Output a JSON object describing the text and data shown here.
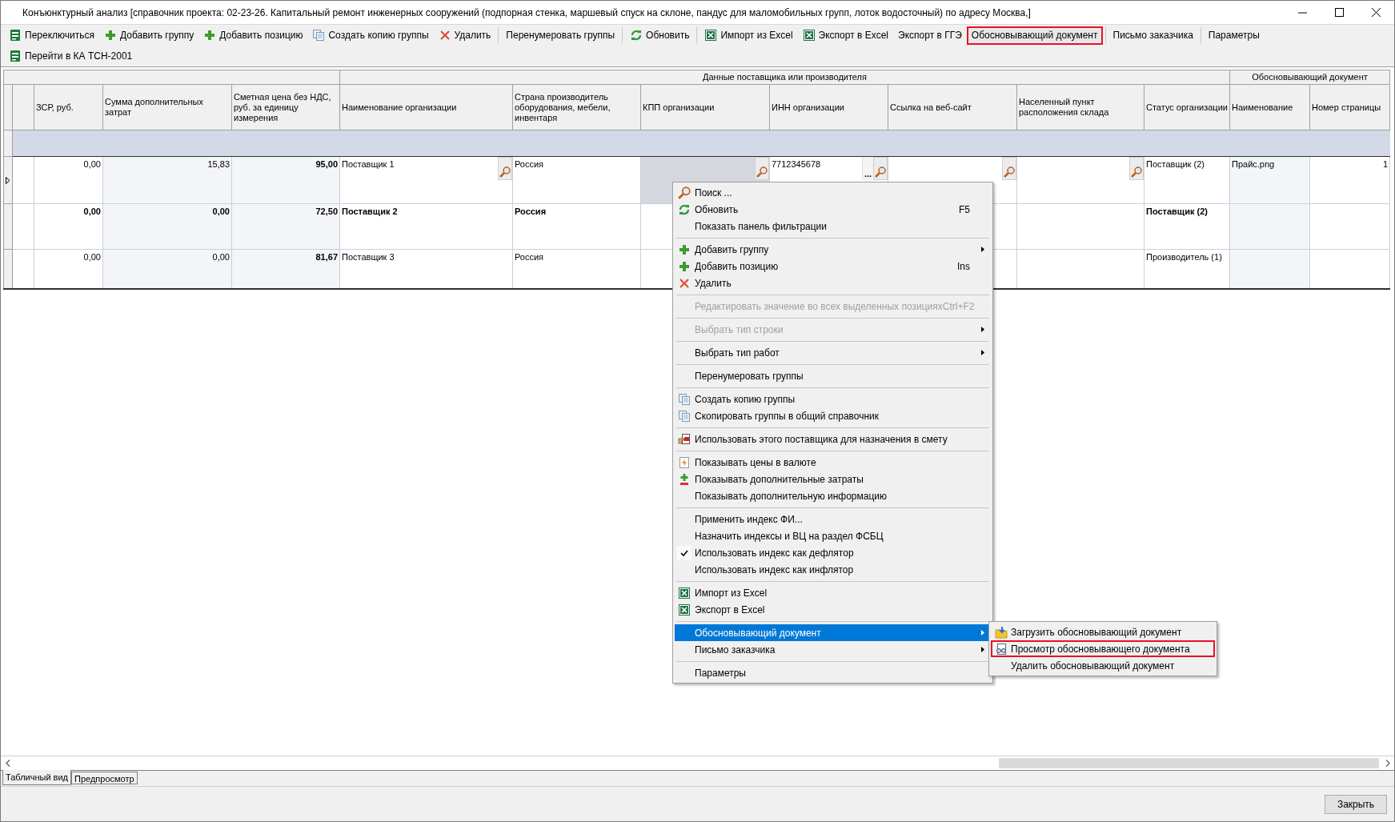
{
  "window": {
    "title": "Конъюнктурный анализ [справочник проекта: 02-23-26. Капитальный ремонт инженерных сооружений (подпорная стенка, маршевый спуск на склоне, пандус для маломобильных групп, лоток водосточный) по адресу Москва,]"
  },
  "toolbar": [
    {
      "label": "Переключиться"
    },
    {
      "label": "Добавить группу"
    },
    {
      "label": "Добавить позицию"
    },
    {
      "label": "Создать копию группы"
    },
    {
      "label": "Удалить"
    },
    {
      "label": "Перенумеровать группы",
      "separator_before": true
    },
    {
      "label": "Обновить",
      "separator_before": true
    },
    {
      "label": "Импорт из Excel",
      "separator_before": true
    },
    {
      "label": "Экспорт в Excel"
    },
    {
      "label": "Экспорт в ГГЭ"
    },
    {
      "label": "Обосновывающий документ",
      "highlighted": true
    },
    {
      "label": "Письмо заказчика",
      "separator_before": true
    },
    {
      "label": "Параметры",
      "separator_before": true
    }
  ],
  "toolbar_2": [
    {
      "label": "Перейти в КА ТСН-2001"
    }
  ],
  "table": {
    "header_groups": [
      {
        "columns": [
          {
            "label": "ЗСР, руб.",
            "kind": "number"
          },
          {
            "label": "Сумма дополнительных затрат",
            "kind": "number",
            "shaded": true
          },
          {
            "label": "Сметная цена без НДС, руб. за единицу измерения",
            "kind": "number",
            "shaded": true,
            "bold": true
          }
        ]
      },
      {
        "label": "Данные поставщика или производителя",
        "columns": [
          {
            "label": "Наименование организации",
            "kind": "text"
          },
          {
            "label": "Страна производитель оборудования, мебели, инвентаря",
            "kind": "text"
          },
          {
            "label": "КПП организации",
            "kind": "text"
          },
          {
            "label": "ИНН организации",
            "kind": "text"
          },
          {
            "label": "Ссылка на веб-сайт",
            "kind": "text"
          },
          {
            "label": "Населенный пункт расположения склада",
            "kind": "text"
          },
          {
            "label": "Статус организации",
            "kind": "text"
          }
        ]
      },
      {
        "label": "Обосновывающий документ",
        "columns": [
          {
            "label": "Наименование",
            "kind": "text",
            "shaded": true
          },
          {
            "label": "Номер страницы",
            "kind": "number"
          }
        ]
      }
    ],
    "rows": [
      {
        "kind": "group"
      },
      {
        "kind": "item",
        "current": true,
        "bold": false,
        "cells": [
          {
            "text": "0,00"
          },
          {
            "text": "15,83"
          },
          {
            "text": "95,00"
          },
          {
            "text": "Поставщик 1",
            "lookup": true
          },
          {
            "text": "Россия"
          },
          {
            "focused": true,
            "lookup": true
          },
          {
            "text": "7712345678",
            "button_text": "...",
            "lookup": true
          },
          {
            "lookup": true
          },
          {
            "lookup": true
          },
          {
            "text": "Поставщик (2)"
          },
          {
            "text": "Прайс.png"
          },
          {
            "text": "1"
          }
        ]
      },
      {
        "kind": "item",
        "current": false,
        "bold": true,
        "cells": [
          {
            "text": "0,00"
          },
          {
            "text": "0,00"
          },
          {
            "text": "72,50"
          },
          {
            "text": "Поставщик 2"
          },
          {
            "text": "Россия"
          },
          {},
          {},
          {},
          {},
          {
            "text": "Поставщик (2)"
          },
          {},
          {}
        ]
      },
      {
        "kind": "item",
        "current": false,
        "bold": false,
        "cells": [
          {
            "text": "0,00"
          },
          {
            "text": "0,00"
          },
          {
            "text": "81,67"
          },
          {
            "text": "Поставщик 3"
          },
          {
            "text": "Россия"
          },
          {},
          {},
          {},
          {},
          {
            "text": "Производитель (1)"
          },
          {},
          {}
        ]
      }
    ]
  },
  "context_menu": [
    {
      "kind": "item",
      "label": "Поиск ..."
    },
    {
      "kind": "item",
      "label": "Обновить",
      "shortcut": "F5"
    },
    {
      "kind": "item",
      "label": "Показать панель фильтрации"
    },
    {
      "kind": "separator"
    },
    {
      "kind": "item",
      "label": "Добавить группу",
      "submenu": true
    },
    {
      "kind": "item",
      "label": "Добавить позицию",
      "shortcut": "Ins"
    },
    {
      "kind": "item",
      "label": "Удалить"
    },
    {
      "kind": "separator"
    },
    {
      "kind": "item",
      "label": "Редактировать значение во всех выделенных позициях",
      "shortcut": "Ctrl+F2",
      "disabled": true
    },
    {
      "kind": "separator"
    },
    {
      "kind": "item",
      "label": "Выбрать тип строки",
      "submenu": true,
      "disabled": true
    },
    {
      "kind": "separator"
    },
    {
      "kind": "item",
      "label": "Выбрать тип работ",
      "submenu": true
    },
    {
      "kind": "separator"
    },
    {
      "kind": "item",
      "label": "Перенумеровать группы"
    },
    {
      "kind": "separator"
    },
    {
      "kind": "item",
      "label": "Создать копию группы"
    },
    {
      "kind": "item",
      "label": "Скопировать группы в общий справочник"
    },
    {
      "kind": "separator"
    },
    {
      "kind": "item",
      "label": "Использовать этого поставщика для назначения в смету"
    },
    {
      "kind": "separator"
    },
    {
      "kind": "item",
      "label": "Показывать цены в валюте"
    },
    {
      "kind": "item",
      "label": "Показывать дополнительные затраты"
    },
    {
      "kind": "item",
      "label": "Показывать дополнительную информацию"
    },
    {
      "kind": "separator"
    },
    {
      "kind": "item",
      "label": "Применить индекс ФИ..."
    },
    {
      "kind": "item",
      "label": "Назначить индексы и ВЦ на раздел ФСБЦ"
    },
    {
      "kind": "item",
      "label": "Использовать индекс как дефлятор",
      "checked": true
    },
    {
      "kind": "item",
      "label": "Использовать индекс как инфлятор",
      "checked": false
    },
    {
      "kind": "separator"
    },
    {
      "kind": "item",
      "label": "Импорт из Excel"
    },
    {
      "kind": "item",
      "label": "Экспорт в Excel"
    },
    {
      "kind": "separator"
    },
    {
      "kind": "item",
      "label": "Обосновывающий документ",
      "submenu": true,
      "selected": true
    },
    {
      "kind": "item",
      "label": "Письмо заказчика",
      "submenu": true,
      "selected": false
    },
    {
      "kind": "separator"
    },
    {
      "kind": "item",
      "label": "Параметры"
    }
  ],
  "submenu": [
    {
      "label": "Загрузить обосновывающий документ",
      "highlighted": false
    },
    {
      "label": "Просмотр обосновывающего документа",
      "highlighted": true
    },
    {
      "label": "Удалить обосновывающий документ",
      "highlighted": false
    }
  ],
  "tabs": [
    {
      "label": "Табличный вид",
      "selected": true
    },
    {
      "label": "Предпросмотр",
      "selected": false
    }
  ],
  "buttons": [
    {
      "label": "Закрыть"
    }
  ]
}
